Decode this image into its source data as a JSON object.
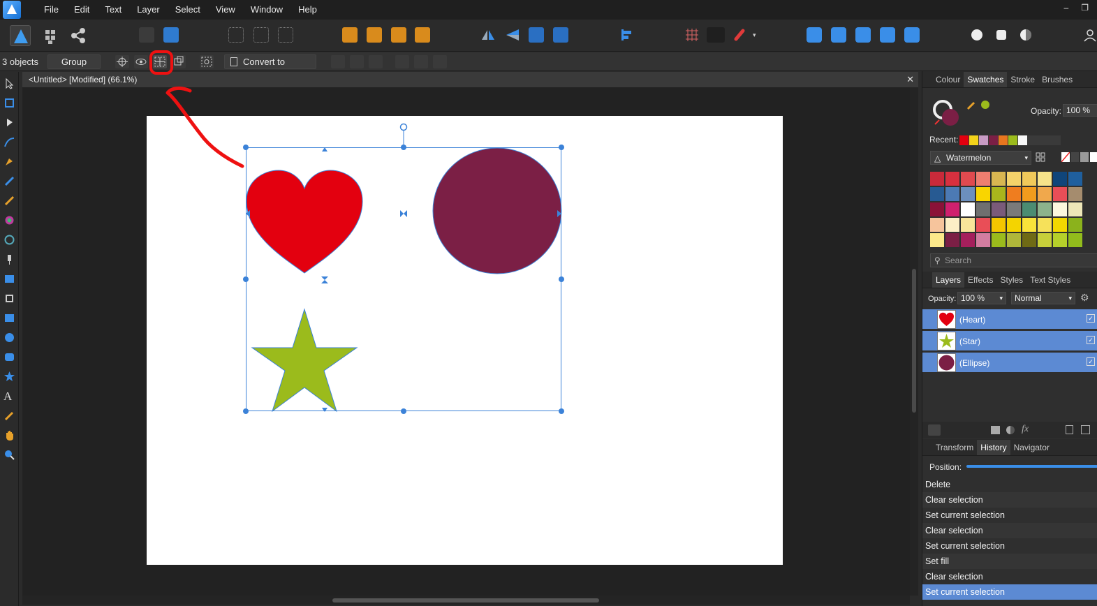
{
  "menu": [
    "File",
    "Edit",
    "Text",
    "Layer",
    "Select",
    "View",
    "Window",
    "Help"
  ],
  "window_controls": {
    "minimize": "–",
    "restore": "❐"
  },
  "context": {
    "selection_count": "3 objects",
    "group_label": "Group",
    "convert_label": "Convert to Curves"
  },
  "document": {
    "title": "<Untitled> [Modified] (66.1%)",
    "close": "✕"
  },
  "right_panel": {
    "top_tabs": [
      "Colour",
      "Swatches",
      "Stroke",
      "Brushes"
    ],
    "opacity_label": "Opacity:",
    "opacity_value": "100 %",
    "recent_label": "Recent:",
    "recent_colors": [
      "#e3000f",
      "#f3d21a",
      "#c89bc4",
      "#7b1f45",
      "#e8761f",
      "#9bbb1c",
      "#f7f7f7"
    ],
    "palette_name": "Watermelon",
    "search_placeholder": "Search",
    "swatches": [
      "#c92a3a",
      "#d7303f",
      "#e04a4f",
      "#ee7e70",
      "#d8b651",
      "#f4d26a",
      "#f0c95a",
      "#f6e38a",
      "#10457a",
      "#1f5f9e",
      "#275a92",
      "#4c7ab4",
      "#6c8fbd",
      "#f9d500",
      "#a9b51c",
      "#ef7d1f",
      "#f29c1d",
      "#f0a84c",
      "#e94e57",
      "#a58c6e",
      "#8b1238",
      "#d0206e",
      "#ffffff",
      "#6f6f6f",
      "#7a5b7a",
      "#7a7a7a",
      "#4b8c72",
      "#8cb38c",
      "#fdf8de",
      "#ede6b8",
      "#f6c49c",
      "#fcefc6",
      "#f9e59a",
      "#e94e57",
      "#f4c600",
      "#f4d400",
      "#f9e23a",
      "#f6e15a",
      "#f2d800",
      "#8bb21c",
      "#fbe88a",
      "#7b1f45",
      "#a51f5c",
      "#d37da0",
      "#9bbb1c",
      "#b0b73a",
      "#6f6a15",
      "#c7cf3a",
      "#b6d02a",
      "#92bc1c"
    ],
    "layers_tabs": [
      "Layers",
      "Effects",
      "Styles",
      "Text Styles"
    ],
    "layers_opacity_label": "Opacity:",
    "layers_opacity_value": "100 %",
    "blend_mode": "Normal",
    "layers": [
      {
        "name": "(Heart)",
        "thumb_color": "#e3000f"
      },
      {
        "name": "(Star)",
        "thumb_color": "#9bbb1c"
      },
      {
        "name": "(Ellipse)",
        "thumb_color": "#7b1f45"
      }
    ],
    "bottom_tabs": [
      "Transform",
      "History",
      "Navigator"
    ],
    "position_label": "Position:",
    "history": [
      "Delete",
      "Clear selection",
      "Set current selection",
      "Clear selection",
      "Set current selection",
      "Set fill",
      "Clear selection",
      "Set current selection"
    ]
  },
  "colors": {
    "heart": "#e3000f",
    "ellipse": "#7b1f45",
    "star": "#9bbb1c",
    "selection": "#3b82d8",
    "annotation": "#ee1111",
    "highlight": "#5c8ad3"
  }
}
